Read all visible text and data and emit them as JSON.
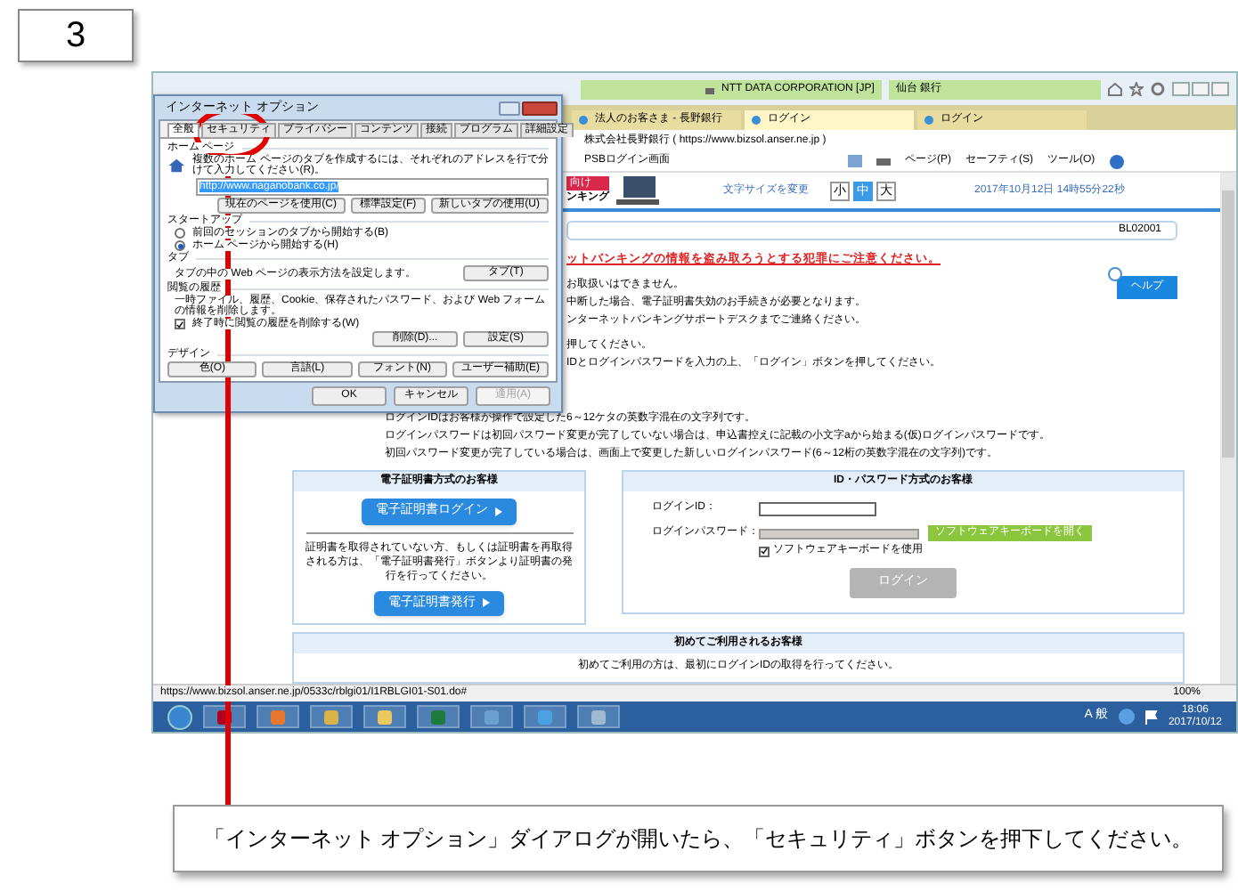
{
  "step": "3",
  "browser": {
    "address": "NTT DATA CORPORATION [JP]",
    "search": "仙台 銀行",
    "tabs": [
      {
        "label": "法人のお客さま - 長野銀行",
        "selected": false
      },
      {
        "label": "ログイン",
        "selected": true
      },
      {
        "label": "ログイン",
        "selected": false
      }
    ],
    "favorites": [
      "株式会社長野銀行 ( https://www.bizsol.anser.ne.jp )",
      "PSBログイン画面"
    ],
    "commands": [
      "ページ(P)",
      "セーフティ(S)",
      "ツール(O)"
    ],
    "status_url": "https://www.bizsol.anser.ne.jp/0533c/rblgi01/I1RBLGI01-S01.do#",
    "zoom": "100%"
  },
  "page": {
    "banner": [
      "向け",
      "ンキング"
    ],
    "font_size_label": "文字サイズを変更",
    "font_sizes": [
      {
        "label": "小",
        "selected": false
      },
      {
        "label": "中",
        "selected": true
      },
      {
        "label": "大",
        "selected": false
      }
    ],
    "datetime": "2017年10月12日 14時55分22秒",
    "screen_id": "BL02001",
    "warning": "ットバンキングの情報を盗み取ろうとする犯罪にご注意ください。",
    "notices": [
      "お取扱いはできません。",
      "中断した場合、電子証明書失効のお手続きが必要となります。",
      "ンターネットバンキングサポートデスクまでご連絡ください。"
    ],
    "help": "ヘルプ",
    "instructions": [
      "押してください。",
      "IDとログインパスワードを入力の上、「ログイン」ボタンを押してください。"
    ],
    "id_notes": [
      "ログインIDはお客様が操作で設定した6～12ケタの英数字混在の文字列です。",
      "ログインパスワードは初回パスワード変更が完了していない場合は、申込書控えに記載の小文字aから始まる(仮)ログインパスワードです。",
      "初回パスワード変更が完了している場合は、画面上で変更した新しいログインパスワード(6～12桁の英数字混在の文字列)です。"
    ],
    "cert_panel": {
      "title": "電子証明書方式のお客様",
      "login_button": "電子証明書ログイン",
      "note": "証明書を取得されていない方、もしくは証明書を再取得される方は、「電子証明書発行」ボタンより証明書の発行を行ってください。",
      "issue_button": "電子証明書発行"
    },
    "id_panel": {
      "title": "ID・パスワード方式のお客様",
      "id_label": "ログインID：",
      "password_label": "ログインパスワード：",
      "keyboard_button": "ソフトウェアキーボードを開く",
      "use_keyboard": {
        "label": "ソフトウェアキーボードを使用",
        "checked": true
      },
      "login_button": "ログイン"
    },
    "first_panel": {
      "title": "初めてご利用されるお客様",
      "text": "初めてご利用の方は、最初にログインIDの取得を行ってください。"
    }
  },
  "taskbar": {
    "ime": "A 般",
    "time": "18:06",
    "date": "2017/10/12"
  },
  "dialog": {
    "title": "インターネット オプション",
    "tabs": [
      {
        "label": "全般",
        "selected": true
      },
      {
        "label": "セキュリティ",
        "selected": false
      },
      {
        "label": "プライバシー",
        "selected": false
      },
      {
        "label": "コンテンツ",
        "selected": false
      },
      {
        "label": "接続",
        "selected": false
      },
      {
        "label": "プログラム",
        "selected": false
      },
      {
        "label": "詳細設定",
        "selected": false
      }
    ],
    "home_group": "ホーム ページ",
    "home_text": "複数のホーム ページのタブを作成するには、それぞれのアドレスを行で分けて入力してください(R)。",
    "home_url": "http://www.naganobank.co.jp/",
    "home_buttons": [
      "現在のページを使用(C)",
      "標準設定(F)",
      "新しいタブの使用(U)"
    ],
    "startup_group": "スタートアップ",
    "startup_options": [
      {
        "label": "前回のセッションのタブから開始する(B)",
        "selected": false
      },
      {
        "label": "ホーム ページから開始する(H)",
        "selected": true
      }
    ],
    "tab_group": "タブ",
    "tab_text": "タブの中の Web ページの表示方法を設定します。",
    "tab_button": "タブ(T)",
    "history_group": "閲覧の履歴",
    "history_text": "一時ファイル、履歴、Cookie、保存されたパスワード、および Web フォームの情報を削除します。",
    "history_check": {
      "label": "終了時に閲覧の履歴を削除する(W)",
      "checked": true
    },
    "history_buttons": [
      "削除(D)...",
      "設定(S)"
    ],
    "design_group": "デザイン",
    "design_buttons": [
      "色(O)",
      "言語(L)",
      "フォント(N)",
      "ユーザー補助(E)"
    ],
    "footer_buttons": [
      {
        "label": "OK",
        "disabled": false
      },
      {
        "label": "キャンセル",
        "disabled": false
      },
      {
        "label": "適用(A)",
        "disabled": true
      }
    ]
  },
  "caption": "「インターネット オプション」ダイアログが開いたら、「セキュリティ」ボタンを押下してください。"
}
